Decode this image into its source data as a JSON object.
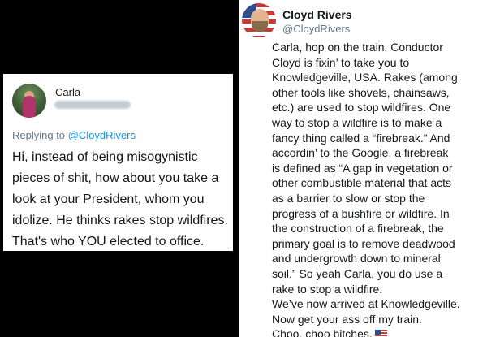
{
  "left_tweet": {
    "author_name": "Carla",
    "reply_prefix": "Replying to",
    "reply_mention": "@CloydRivers",
    "body": "Hi, instead of being misogynistic pieces of shit, how about you take a look at your President, whom you idolize. He thinks rakes stop wildfires. That's who YOU elected to office."
  },
  "right_tweet": {
    "author_name": "Cloyd Rivers",
    "handle": "@CloydRivers",
    "body_lines": [
      "Carla, hop on the train. Conductor",
      "Cloyd is fixin’ to take you to",
      "Knowledgeville, USA. Rakes (among",
      "other tools like shovels, chainsaws,",
      "etc.) are used to stop wildfires. One",
      "way to stop a wildfire is to make a",
      "fancy thing called a “firebreak.” And",
      "accordin’ to the Google, a firebreak",
      "is defined as “A gap in vegetation or",
      "other combustible material that acts",
      "as a barrier to slow or stop the",
      "progress of a bushfire or wildfire. In",
      "the construction of a firebreak, the",
      "primary goal is to remove deadwood",
      "and undergrowth down to mineral",
      "soil.” So yeah Carla, you do use a",
      "rake to stop a wildfire.",
      "We’ve now arrived at Knowledgeville.",
      "Now get your ass off my train.",
      "Choo, choo bitches."
    ],
    "trailing_emoji": "us-flag-emoji"
  }
}
